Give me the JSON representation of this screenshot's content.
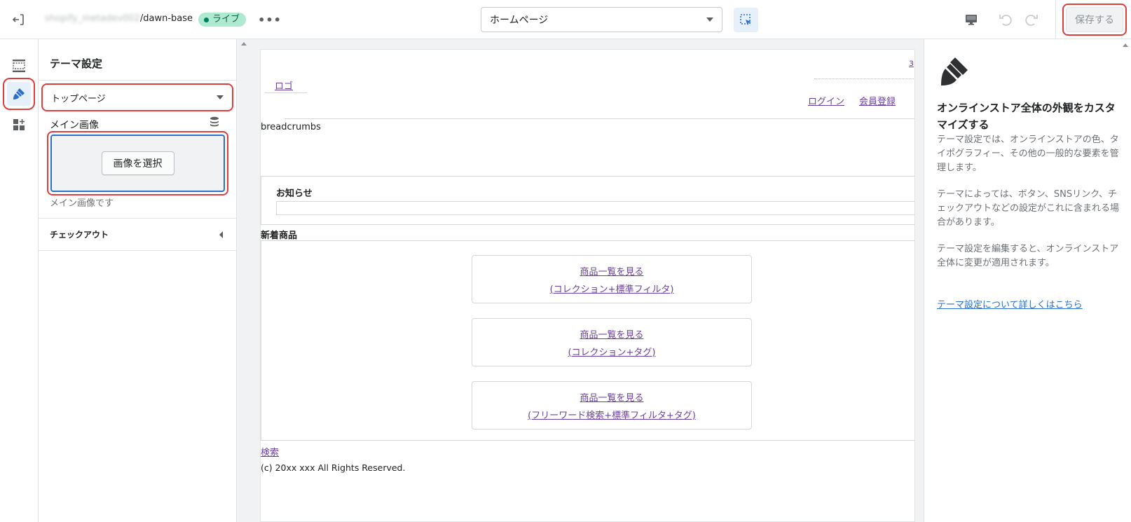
{
  "topbar": {
    "store_prefix": "shopify_metadev002",
    "store_suffix": "/dawn-base",
    "live_badge": "ライブ",
    "more_label": "•••",
    "page_select_value": "ホームページ",
    "save_label": "保存する"
  },
  "settings": {
    "title": "テーマ設定",
    "section_select_value": "トップページ",
    "main_image_label": "メイン画像",
    "choose_image_label": "画像を選択",
    "main_image_help": "メイン画像です",
    "checkout_label": "チェックアウト"
  },
  "preview": {
    "top_right_link": "з",
    "logo_link": "ロゴ",
    "login_link": "ログイン",
    "register_link": "会員登録",
    "breadcrumbs": "breadcrumbs",
    "notice_title": "お知らせ",
    "new_products_title": "新着商品",
    "cards": [
      {
        "line1": "商品一覧を見る",
        "line2": "(コレクション+標準フィルタ)"
      },
      {
        "line1": "商品一覧を見る",
        "line2": "(コレクション+タグ)"
      },
      {
        "line1": "商品一覧を見る",
        "line2": "(フリーワード検索+標準フィルタ+タグ)"
      }
    ],
    "search_link": "検索",
    "copyright": "(c) 20xx xxx All Rights Reserved."
  },
  "info": {
    "heading": "オンラインストア全体の外観をカスタマイズする",
    "p1": "テーマ設定では、オンラインストアの色、タイポグラフィー、その他の一般的な要素を管理します。",
    "p2": "テーマによっては、ボタン、SNSリンク、チェックアウトなどの設定がこれに含まれる場合があります。",
    "p3": "テーマ設定を編集すると、オンラインストア全体に変更が適用されます。",
    "link": "テーマ設定について詳しくはこちら"
  },
  "icons": {
    "exit": "exit-icon",
    "inspect": "inspector-icon",
    "device": "desktop-icon",
    "undo": "undo-icon",
    "redo": "redo-icon",
    "sections": "sections-icon",
    "theme_settings": "paintbrush-icon",
    "apps": "apps-icon",
    "data_source": "database-icon"
  },
  "colors": {
    "accent": "#2c6ecb",
    "highlight": "#e03d3d",
    "live": "#aee9d1",
    "link_visited": "#6b3fa0"
  }
}
